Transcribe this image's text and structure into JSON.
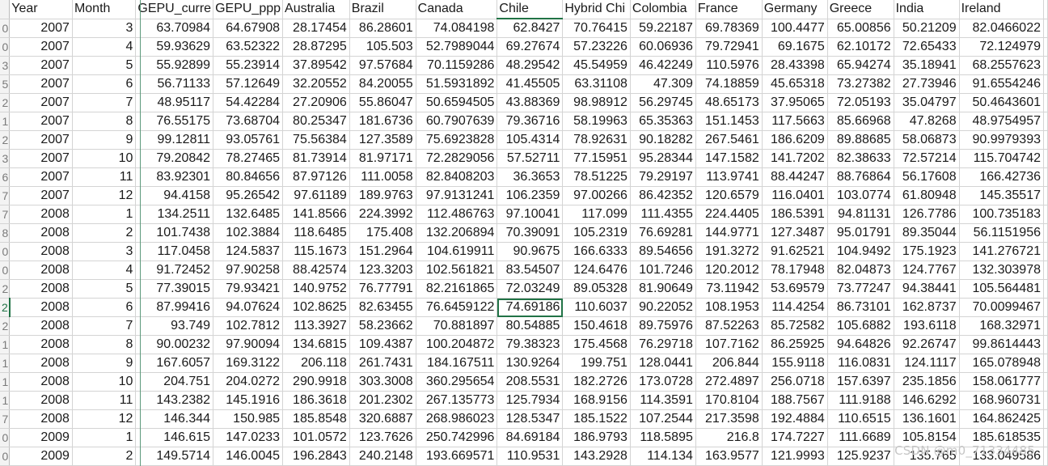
{
  "headers": [
    "Year",
    "Month",
    "GEPU_curre",
    "GEPU_ppp",
    "Australia",
    "Brazil",
    "Canada",
    "Chile",
    "Hybrid Chi",
    "Colombia",
    "France",
    "Germany",
    "Greece",
    "India",
    "Ireland"
  ],
  "row_markers": [
    "0",
    "0",
    "3",
    "5",
    "2",
    "1",
    "2",
    "3",
    "6",
    "7",
    "7",
    "8",
    "0",
    "0",
    "2",
    "2",
    "2",
    "1",
    "1",
    "1",
    "1",
    "7",
    "0",
    "0"
  ],
  "rows": [
    [
      "2007",
      "3",
      "63.70984",
      "64.67908",
      "28.17454",
      "86.28601",
      "74.084198",
      "62.8427",
      "70.76415",
      "59.22187",
      "69.78369",
      "100.4477",
      "65.00856",
      "50.21209",
      "82.0466022"
    ],
    [
      "2007",
      "4",
      "59.93629",
      "63.52322",
      "28.87295",
      "105.503",
      "52.7989044",
      "69.27674",
      "57.23226",
      "60.06936",
      "79.72941",
      "69.1675",
      "62.10172",
      "72.65433",
      "72.124979"
    ],
    [
      "2007",
      "5",
      "55.92899",
      "55.23914",
      "37.89542",
      "97.57684",
      "70.1159286",
      "48.29542",
      "45.54959",
      "46.42249",
      "110.5976",
      "28.43398",
      "65.94274",
      "35.18941",
      "68.2557623"
    ],
    [
      "2007",
      "6",
      "56.71133",
      "57.12649",
      "32.20552",
      "84.20055",
      "51.5931892",
      "41.45505",
      "63.31108",
      "47.309",
      "74.18859",
      "45.65318",
      "73.27382",
      "27.73946",
      "91.6554246"
    ],
    [
      "2007",
      "7",
      "48.95117",
      "54.42284",
      "27.20906",
      "55.86047",
      "50.6594505",
      "43.88369",
      "98.98912",
      "56.29745",
      "48.65173",
      "37.95065",
      "72.05193",
      "35.04797",
      "50.4643601"
    ],
    [
      "2007",
      "8",
      "76.55175",
      "73.68704",
      "80.25347",
      "181.6736",
      "60.7907639",
      "79.36716",
      "58.19963",
      "65.35363",
      "151.1453",
      "117.5663",
      "85.66968",
      "47.8268",
      "48.9754957"
    ],
    [
      "2007",
      "9",
      "99.12811",
      "93.05761",
      "75.56384",
      "127.3589",
      "75.6923828",
      "105.4314",
      "78.92631",
      "90.18282",
      "267.5461",
      "186.6209",
      "89.88685",
      "58.06873",
      "90.9979393"
    ],
    [
      "2007",
      "10",
      "79.20842",
      "78.27465",
      "81.73914",
      "81.97171",
      "72.2829056",
      "57.52711",
      "77.15951",
      "95.28344",
      "147.1582",
      "141.7202",
      "82.38633",
      "72.57214",
      "115.704742"
    ],
    [
      "2007",
      "11",
      "83.92301",
      "80.84656",
      "87.97126",
      "111.0058",
      "82.8408203",
      "36.3653",
      "78.51225",
      "79.29197",
      "113.9741",
      "88.44247",
      "88.76864",
      "56.17608",
      "166.42736"
    ],
    [
      "2007",
      "12",
      "94.4158",
      "95.26542",
      "97.61189",
      "189.9763",
      "97.9131241",
      "106.2359",
      "97.00266",
      "86.42352",
      "120.6579",
      "116.0401",
      "103.0774",
      "61.80948",
      "145.35517"
    ],
    [
      "2008",
      "1",
      "134.2511",
      "132.6485",
      "141.8566",
      "224.3992",
      "112.486763",
      "97.10041",
      "117.099",
      "111.4355",
      "224.4405",
      "186.5391",
      "94.81131",
      "126.7786",
      "100.735183"
    ],
    [
      "2008",
      "2",
      "101.7438",
      "102.3884",
      "118.6485",
      "175.408",
      "132.206894",
      "70.39091",
      "105.2319",
      "76.69281",
      "144.9771",
      "127.3487",
      "95.01791",
      "89.35044",
      "56.1151956"
    ],
    [
      "2008",
      "3",
      "117.0458",
      "124.5837",
      "115.1673",
      "151.2964",
      "104.619911",
      "90.9675",
      "166.6333",
      "89.54656",
      "191.3272",
      "91.62521",
      "104.9492",
      "175.1923",
      "141.276721"
    ],
    [
      "2008",
      "4",
      "91.72452",
      "97.90258",
      "88.42574",
      "123.3203",
      "102.561821",
      "83.54507",
      "124.6476",
      "101.7246",
      "120.2012",
      "78.17948",
      "82.04873",
      "124.7767",
      "132.303978"
    ],
    [
      "2008",
      "5",
      "77.39015",
      "79.93421",
      "140.9752",
      "76.77791",
      "82.2161865",
      "72.03249",
      "89.05328",
      "81.90649",
      "73.11942",
      "53.69579",
      "73.77247",
      "94.38441",
      "105.564481"
    ],
    [
      "2008",
      "6",
      "87.99416",
      "94.07624",
      "102.8625",
      "82.63455",
      "76.6459122",
      "74.69186",
      "110.6037",
      "90.22052",
      "108.1953",
      "114.4254",
      "86.73101",
      "162.8737",
      "70.0099467"
    ],
    [
      "2008",
      "7",
      "93.749",
      "102.7812",
      "113.3927",
      "58.23662",
      "70.881897",
      "80.54885",
      "150.4618",
      "89.75976",
      "87.52263",
      "85.72582",
      "105.6882",
      "193.6118",
      "168.32971"
    ],
    [
      "2008",
      "8",
      "90.00232",
      "97.90094",
      "134.6815",
      "109.4387",
      "100.204872",
      "79.38323",
      "175.4568",
      "76.29718",
      "107.7162",
      "86.25925",
      "94.64826",
      "92.26747",
      "99.8614443"
    ],
    [
      "2008",
      "9",
      "167.6057",
      "169.3122",
      "206.118",
      "261.7431",
      "184.167511",
      "130.9264",
      "199.751",
      "128.0441",
      "206.844",
      "155.9118",
      "116.0831",
      "124.1117",
      "165.078948"
    ],
    [
      "2008",
      "10",
      "204.751",
      "204.0272",
      "290.9918",
      "303.3008",
      "360.295654",
      "208.5531",
      "182.2726",
      "173.0728",
      "272.4897",
      "256.0718",
      "157.6397",
      "235.1856",
      "158.061777"
    ],
    [
      "2008",
      "11",
      "143.2382",
      "145.1916",
      "186.3618",
      "201.2302",
      "267.135773",
      "125.7934",
      "168.9156",
      "114.3591",
      "170.8104",
      "188.7567",
      "111.9188",
      "146.6292",
      "168.960731"
    ],
    [
      "2008",
      "12",
      "146.344",
      "150.985",
      "185.8548",
      "320.6887",
      "268.986023",
      "128.5347",
      "185.1522",
      "107.2544",
      "217.3598",
      "192.4884",
      "110.6515",
      "136.1601",
      "164.862425"
    ],
    [
      "2009",
      "1",
      "146.615",
      "147.0233",
      "101.0572",
      "123.7626",
      "250.742996",
      "84.69184",
      "186.9793",
      "118.5895",
      "216.8",
      "174.7227",
      "111.6689",
      "105.8154",
      "185.618535"
    ],
    [
      "2009",
      "2",
      "149.5714",
      "146.0045",
      "196.2843",
      "240.2148",
      "193.669571",
      "110.9531",
      "143.2928",
      "114.134",
      "163.9577",
      "121.9993",
      "125.9237",
      "135.765",
      "133.049586"
    ]
  ],
  "selection": {
    "row_index": 15,
    "col_index": 7
  },
  "watermark": "CSDN @m0_71334485"
}
